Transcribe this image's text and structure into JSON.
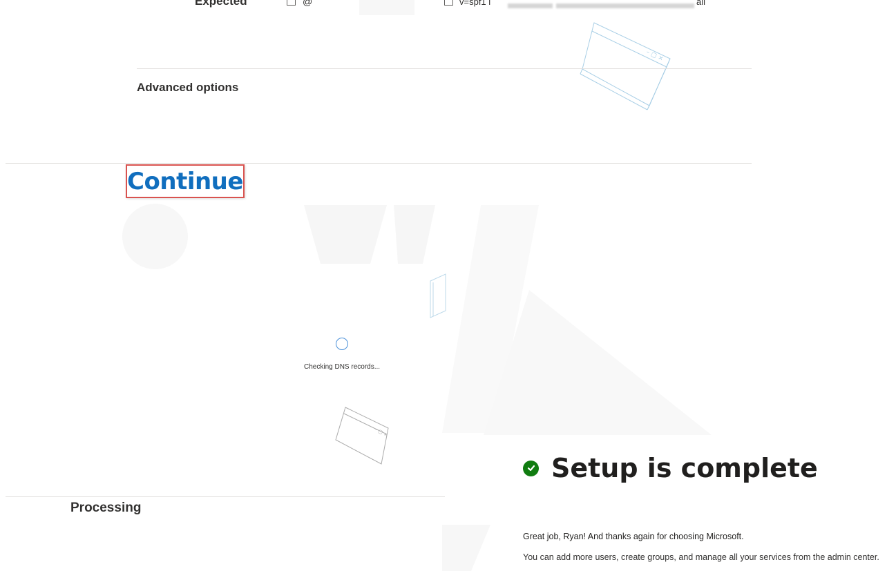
{
  "dns_table_row": {
    "label": "Expected",
    "value_prefix": "@",
    "value_text": "v=spf1 i",
    "value_suffix": "all"
  },
  "advanced_options": {
    "label": "Advanced options"
  },
  "continue": {
    "label": "Continue"
  },
  "loading": {
    "status_text": "Checking DNS records..."
  },
  "processing": {
    "label": "Processing"
  },
  "setup": {
    "title": "Setup is complete",
    "greeting": "Great job, Ryan! And thanks again for choosing Microsoft.",
    "description": "You can add more users, create groups, and manage all your services from the admin center."
  },
  "colors": {
    "accent": "#106ebe",
    "highlight_border": "#d9534f",
    "success": "#107c10"
  }
}
